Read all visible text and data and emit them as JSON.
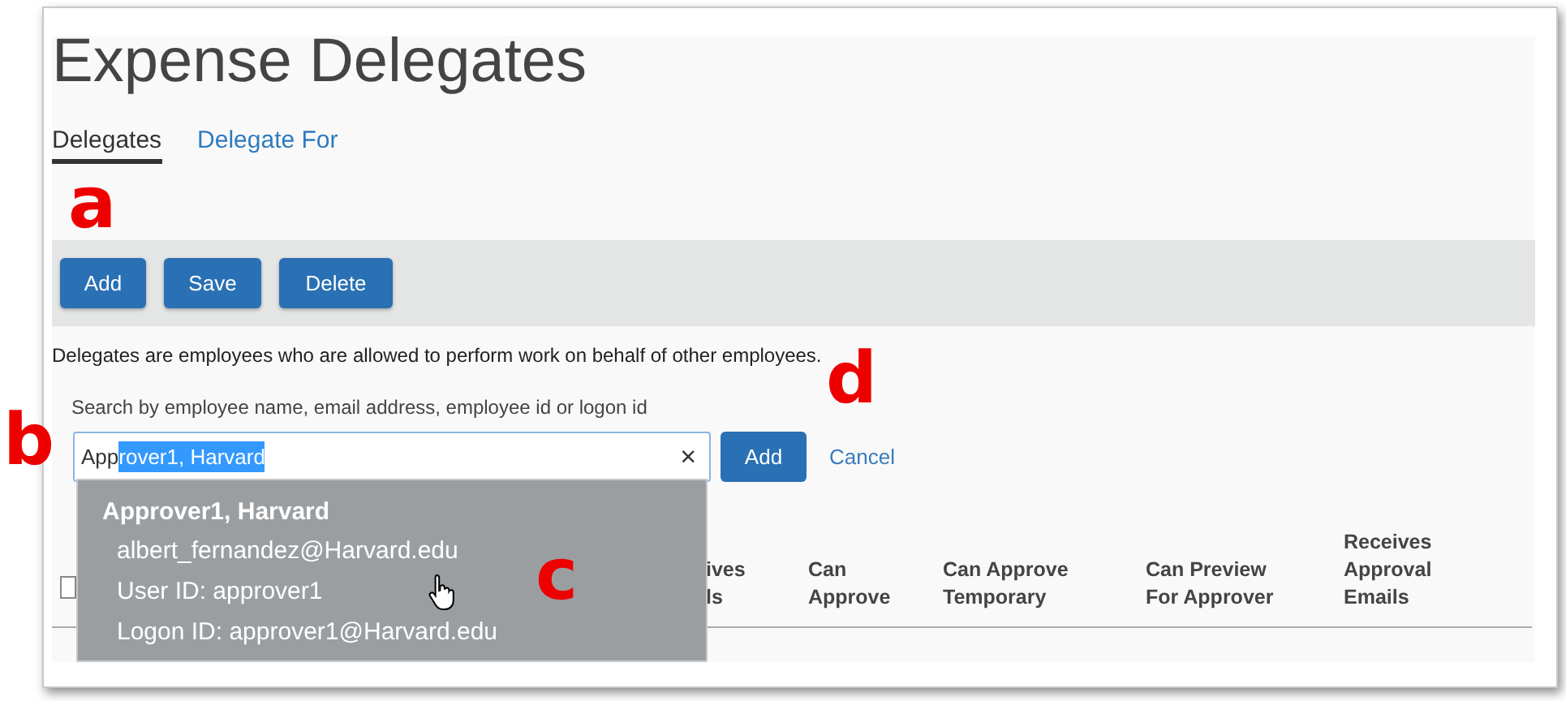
{
  "page": {
    "title": "Expense Delegates"
  },
  "tabs": [
    {
      "label": "Delegates",
      "selected": true
    },
    {
      "label": "Delegate For",
      "selected": false
    }
  ],
  "toolbar": {
    "buttons": [
      "Add",
      "Save",
      "Delete"
    ]
  },
  "description": "Delegates are employees who are allowed to perform work on behalf of other employees.",
  "search": {
    "label": "Search by employee name, email address, employee id or logon id",
    "value_plain": "App",
    "value_selected": "rover1, Harvard",
    "clear": "×",
    "add_button": "Add",
    "cancel_link": "Cancel"
  },
  "suggestions": [
    {
      "name": "Approver1, Harvard",
      "email": "albert_fernandez@Harvard.edu",
      "user_id": "User ID: approver1",
      "logon_id": "Logon ID: approver1@Harvard.edu",
      "highlighted": true
    }
  ],
  "table": {
    "select_all": {
      "checked": false
    },
    "columns": [
      {
        "lines": [
          "ives",
          "ls"
        ]
      },
      {
        "lines": [
          "Can",
          "Approve"
        ]
      },
      {
        "lines": [
          "Can Approve",
          "Temporary"
        ]
      },
      {
        "lines": [
          "Can Preview",
          "For Approver"
        ]
      },
      {
        "lines": [
          "Receives",
          "Approval",
          "Emails"
        ]
      }
    ]
  },
  "annotations": [
    {
      "label": "a"
    },
    {
      "label": "b"
    },
    {
      "label": "c"
    },
    {
      "label": "d"
    }
  ]
}
